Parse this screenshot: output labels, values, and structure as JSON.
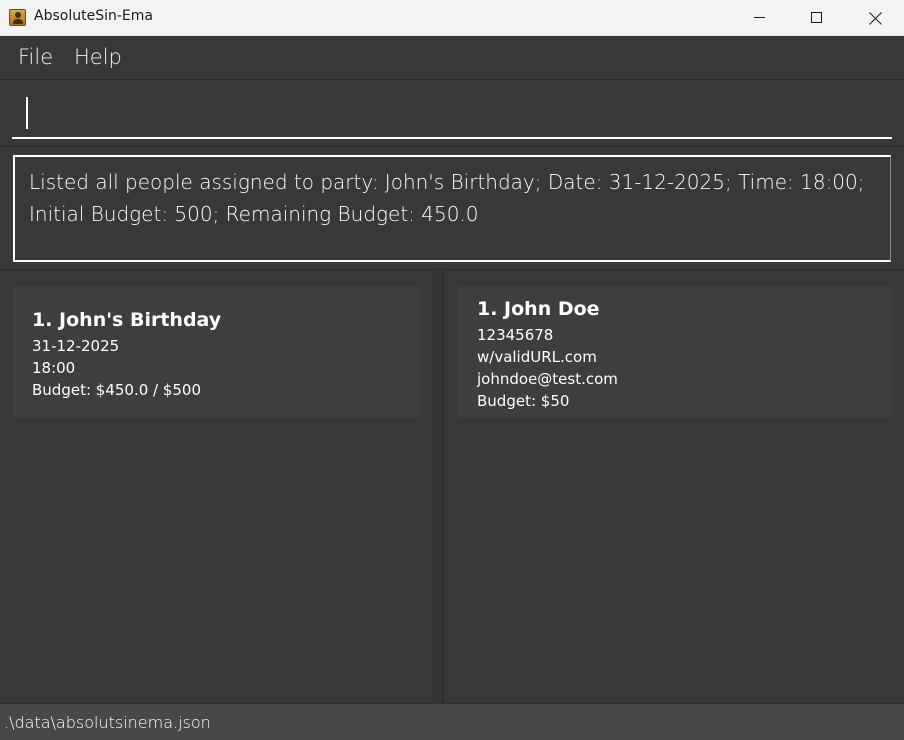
{
  "window": {
    "title": "AbsoluteSin-Ema"
  },
  "menu": {
    "file_label": "File",
    "help_label": "Help"
  },
  "command": {
    "value": "",
    "placeholder": ""
  },
  "result": {
    "message": "Listed all people assigned to party: John's Birthday; Date: 31-12-2025; Time: 18:00; Initial Budget: 500; Remaining Budget: 450.0"
  },
  "parties": [
    {
      "title": "1. John's Birthday",
      "date": "31-12-2025",
      "time": "18:00",
      "budget": "Budget: $450.0 / $500"
    }
  ],
  "persons": [
    {
      "title": "1. John Doe",
      "phone": "12345678",
      "url": "w/validURL.com",
      "email": "johndoe@test.com",
      "budget": "Budget: $50"
    }
  ],
  "status": {
    "file_path": ".\\data\\absolutsinema.json"
  },
  "colors": {
    "background": "#383838",
    "card": "#3c3e3f",
    "text": "#ffffff",
    "titlebar": "#f3f3f3"
  }
}
